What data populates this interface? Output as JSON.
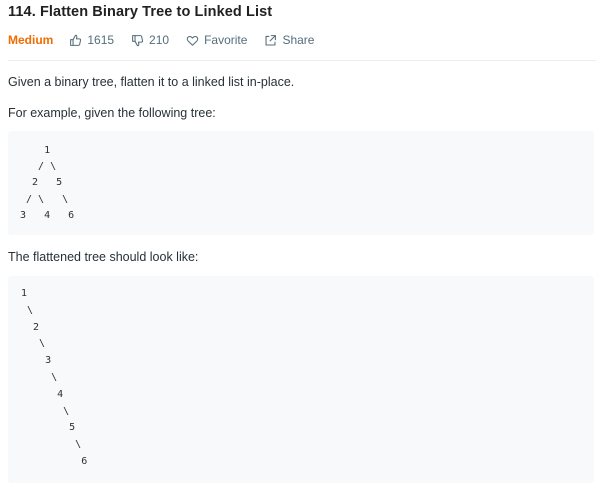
{
  "problem": {
    "title": "114. Flatten Binary Tree to Linked List",
    "difficulty": "Medium",
    "likes": "1615",
    "dislikes": "210",
    "favorite_label": "Favorite",
    "share_label": "Share"
  },
  "description": {
    "intro": "Given a binary tree, flatten it to a linked list in-place.",
    "example_intro": "For example, given the following tree:",
    "example_tree": "    1\n   / \\\n  2   5\n / \\   \\\n3   4   6",
    "result_intro": "The flattened tree should look like:",
    "result_tree": "1\n \\\n  2\n   \\\n    3\n     \\\n      4\n       \\\n        5\n         \\\n          6"
  },
  "colors": {
    "difficulty_medium": "#ef6c00",
    "meta_text": "#546e7a",
    "code_background": "#f7f9fa"
  },
  "icons": {
    "likes": "thumbs-up-icon",
    "dislikes": "thumbs-down-icon",
    "favorite": "heart-icon",
    "share": "share-icon"
  }
}
